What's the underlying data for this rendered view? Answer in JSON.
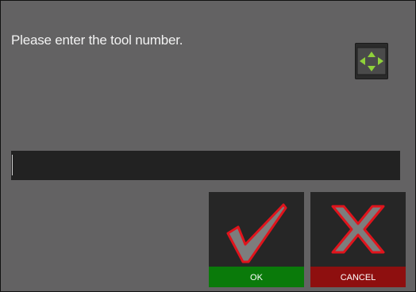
{
  "dialog": {
    "prompt": "Please enter the tool number.",
    "input_value": ""
  },
  "buttons": {
    "ok_label": "OK",
    "cancel_label": "CANCEL"
  },
  "icons": {
    "move": "move-arrows-icon",
    "ok": "checkmark-icon",
    "cancel": "cross-icon"
  },
  "colors": {
    "background": "#636263",
    "input_background": "#222222",
    "ok_bar": "#0a7a0a",
    "cancel_bar": "#8e0f0f",
    "glyph_outline": "#e0141c",
    "move_arrows": "#8fd13a"
  }
}
